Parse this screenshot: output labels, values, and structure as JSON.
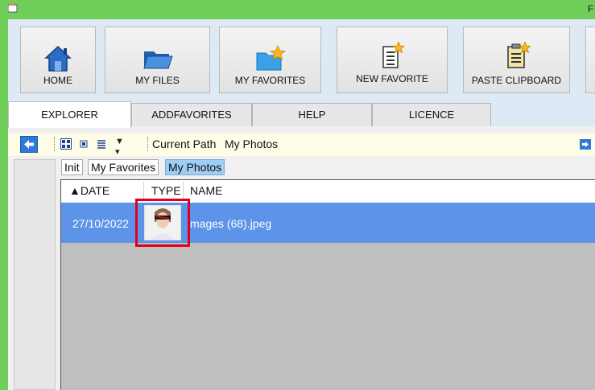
{
  "window": {
    "title": "F"
  },
  "ribbon": {
    "buttons": [
      {
        "label": "HOME",
        "icon": "home-icon"
      },
      {
        "label": "MY FILES",
        "icon": "folder-open-icon"
      },
      {
        "label": "MY FAVORITES",
        "icon": "folder-star-icon"
      },
      {
        "label": "NEW FAVORITE",
        "icon": "document-star-icon"
      },
      {
        "label": "PASTE CLIPBOARD",
        "icon": "clipboard-star-icon"
      }
    ]
  },
  "tabs": [
    {
      "label": "EXPLORER",
      "active": true
    },
    {
      "label": "ADDFAVORITES",
      "active": false
    },
    {
      "label": "HELP",
      "active": false
    },
    {
      "label": "LICENCE",
      "active": false
    }
  ],
  "pathbar": {
    "label": "Current Path",
    "value": "My Photos"
  },
  "breadcrumbs": [
    {
      "label": "Init",
      "active": false
    },
    {
      "label": "My Favorites",
      "active": false
    },
    {
      "label": "My Photos",
      "active": true
    }
  ],
  "filelist": {
    "columns": [
      {
        "label": "DATE",
        "sort": "ascending",
        "sort_glyph": "▲"
      },
      {
        "label": "TYPE"
      },
      {
        "label": "NAME"
      }
    ],
    "rows": [
      {
        "date": "27/10/2022",
        "type": "image-thumbnail",
        "name": "mages (68).jpeg",
        "selected": true
      }
    ]
  },
  "colors": {
    "titlebar": "#6fcf5a",
    "ribbon_bg": "#dde9f5",
    "selection": "#5d93e8",
    "highlight_box": "#e0001b",
    "path_bg": "#fefee8"
  }
}
